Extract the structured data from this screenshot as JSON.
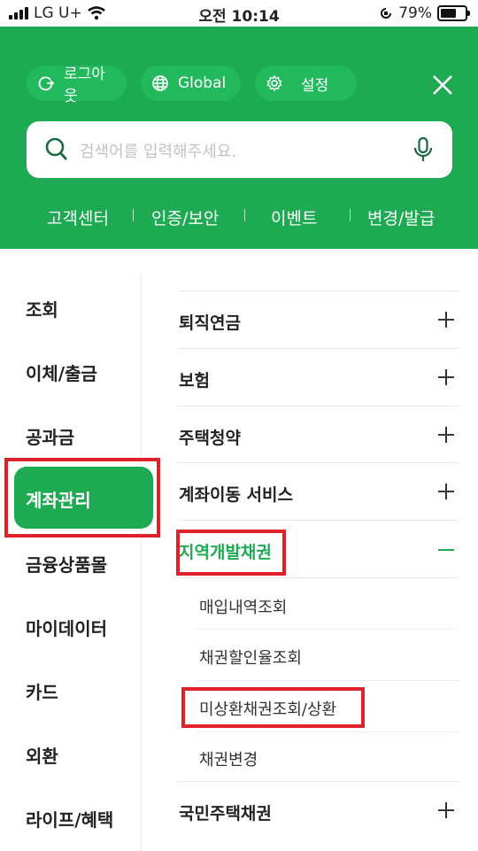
{
  "status_bar": {
    "carrier": "LG U+",
    "time": "오전 10:14",
    "battery": "79%",
    "battery_level": 0.79
  },
  "header": {
    "logout_label": "로그아웃",
    "global_label": "Global",
    "settings_label": "설정",
    "search_placeholder": "검색어를 입력해주세요.",
    "quick_links": [
      "고객센터",
      "인증/보안",
      "이벤트",
      "변경/발급"
    ],
    "background_color": "#1daa53"
  },
  "left_menu": {
    "items": [
      "조회",
      "이체/출금",
      "공과금",
      "계좌관리",
      "금융상품몰",
      "마이데이터",
      "카드",
      "외환",
      "라이프/혜택"
    ],
    "active": "계좌관리"
  },
  "right_menu": {
    "items": [
      {
        "label": "퇴직연금"
      },
      {
        "label": "보험"
      },
      {
        "label": "주택청약"
      },
      {
        "label": "계좌이동 서비스"
      },
      {
        "label": "지역개발채권",
        "expanded": true,
        "children": [
          "매입내역조회",
          "채권할인율조회",
          "미상환채권조회/상환",
          "채권변경"
        ]
      },
      {
        "label": "국민주택채권"
      }
    ]
  },
  "colors": {
    "accent": "#1daa53",
    "highlight": "#e0212a"
  }
}
